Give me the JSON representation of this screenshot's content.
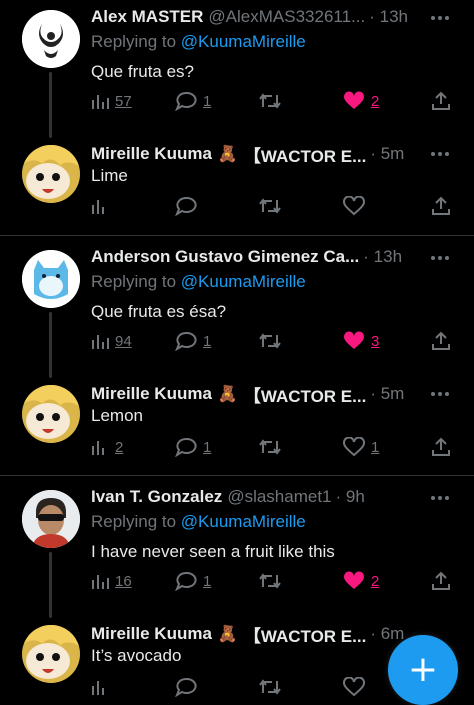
{
  "tweets": [
    {
      "name": "Alex MASTER",
      "handle": "@AlexMAS332611...",
      "time": "· 13h",
      "reply_prefix": "Replying to ",
      "reply_to": "@KuumaMireille",
      "text": "Que fruta es?",
      "views": "57",
      "replies": "1",
      "retweets": "",
      "likes": "2",
      "liked": true
    },
    {
      "name": "Mireille Kuuma",
      "name_suffix": "【WACTOR E...",
      "time": "· 5m",
      "text": "Lime",
      "views": "",
      "replies": "",
      "retweets": "",
      "likes": ""
    },
    {
      "name": "Anderson Gustavo Gimenez Ca...",
      "time": "· 13h",
      "reply_prefix": "Replying to ",
      "reply_to": "@KuumaMireille",
      "text": "Que fruta es ésa?",
      "views": "94",
      "replies": "1",
      "retweets": "",
      "likes": "3",
      "liked": true
    },
    {
      "name": "Mireille Kuuma",
      "name_suffix": "【WACTOR E...",
      "time": "· 5m",
      "text": "Lemon",
      "views": "2",
      "replies": "1",
      "retweets": "",
      "likes": "1"
    },
    {
      "name": "Ivan T. Gonzalez",
      "handle": "@slashamet1",
      "time": "· 9h",
      "reply_prefix": "Replying to ",
      "reply_to": "@KuumaMireille",
      "text": "I have never seen a fruit like this",
      "views": "16",
      "replies": "1",
      "retweets": "",
      "likes": "2",
      "liked": true
    },
    {
      "name": "Mireille Kuuma",
      "name_suffix": "【WACTOR E...",
      "time": "· 6m",
      "text": "It’s avocado",
      "views": "",
      "replies": "",
      "retweets": "",
      "likes": ""
    }
  ],
  "fab": {
    "label": "+"
  },
  "colors": {
    "accent": "#1d9bf0",
    "like": "#f91880",
    "muted": "#71767b",
    "background": "#000000"
  }
}
